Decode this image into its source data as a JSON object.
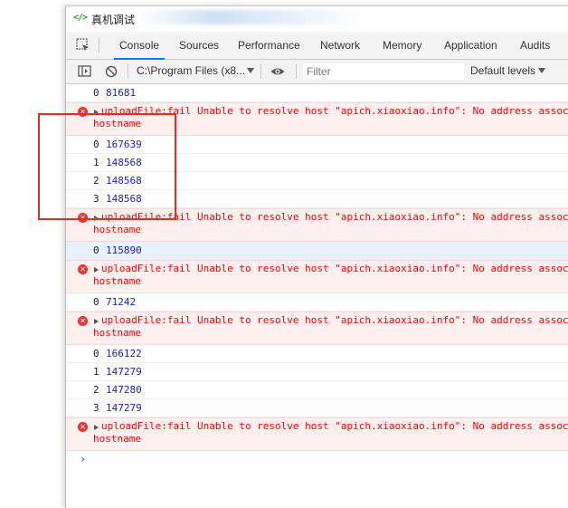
{
  "window": {
    "title": "真机调试",
    "app_icon": "</>"
  },
  "tabs": [
    {
      "label": "Console",
      "active": true
    },
    {
      "label": "Sources"
    },
    {
      "label": "Performance"
    },
    {
      "label": "Network"
    },
    {
      "label": "Memory"
    },
    {
      "label": "Application"
    },
    {
      "label": "Audits"
    }
  ],
  "toolbar": {
    "context": "C:\\Program Files (x8...",
    "filter_placeholder": "Filter",
    "levels": "Default levels"
  },
  "console": {
    "rows": [
      {
        "type": "log",
        "index": "0",
        "value": "81681"
      },
      {
        "type": "error",
        "message": "uploadFile:fail Unable to resolve host \"apich.xiaoxiao.info\": No address associated with",
        "continuation": "hostname"
      },
      {
        "type": "log",
        "index": "0",
        "value": "167639"
      },
      {
        "type": "log",
        "index": "1",
        "value": "148568"
      },
      {
        "type": "log",
        "index": "2",
        "value": "148568"
      },
      {
        "type": "log",
        "index": "3",
        "value": "148568"
      },
      {
        "type": "error",
        "message": "uploadFile:fail Unable to resolve host \"apich.xiaoxiao.info\": No address associated with",
        "continuation": "hostname"
      },
      {
        "type": "log",
        "index": "0",
        "value": "115890",
        "highlight": true
      },
      {
        "type": "error",
        "message": "uploadFile:fail Unable to resolve host \"apich.xiaoxiao.info\": No address associated with",
        "continuation": "hostname"
      },
      {
        "type": "log",
        "index": "0",
        "value": "71242"
      },
      {
        "type": "error",
        "message": "uploadFile:fail Unable to resolve host \"apich.xiaoxiao.info\": No address associated with",
        "continuation": "hostname"
      },
      {
        "type": "log",
        "index": "0",
        "value": "166122"
      },
      {
        "type": "log",
        "index": "1",
        "value": "147279"
      },
      {
        "type": "log",
        "index": "2",
        "value": "147280"
      },
      {
        "type": "log",
        "index": "3",
        "value": "147279"
      },
      {
        "type": "error",
        "message": "uploadFile:fail Unable to resolve host \"apich.xiaoxiao.info\": No address associated with",
        "continuation": "hostname"
      }
    ],
    "prompt_symbol": "›"
  },
  "colors": {
    "accent": "#1a73e8",
    "error_text": "#ff0000",
    "error_bg": "#fff0f0",
    "value_text": "#1c1cc8",
    "annotation": "#ee2a1b"
  }
}
